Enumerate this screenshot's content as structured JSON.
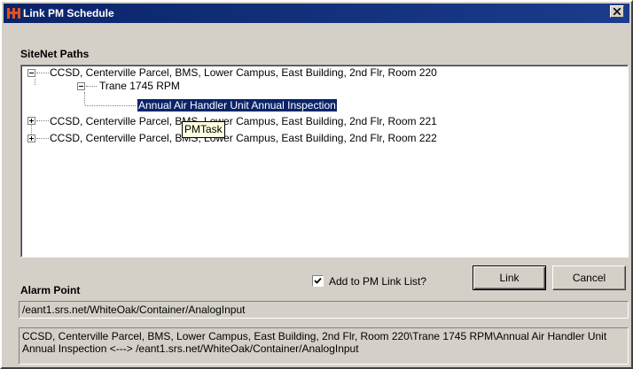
{
  "window": {
    "title": "Link PM Schedule",
    "colors": {
      "titlebar": "#0a246a",
      "face": "#d4d0c8",
      "selection": "#0a246a",
      "tooltip": "#ffffe1"
    }
  },
  "sitenet": {
    "label": "SiteNet Paths",
    "nodes": [
      {
        "text": "CCSD, Centerville Parcel, BMS, Lower Campus, East  Building, 2nd Flr, Room 220",
        "expander": "minus"
      },
      {
        "text": "Trane 1745 RPM",
        "expander": "minus"
      },
      {
        "text": "Annual Air Handler Unit Annual Inspection",
        "selected": true
      },
      {
        "text": "CCSD, Centerville Parcel, BMS, Lower Campus, East  Building, 2nd Flr, Room 221",
        "expander": "plus"
      },
      {
        "text": "CCSD, Centerville Parcel, BMS, Lower Campus, East  Building, 2nd Flr, Room 222",
        "expander": "plus"
      }
    ],
    "tooltip": "PMTask"
  },
  "options": {
    "add_to_list_label": "Add to PM Link List?",
    "add_to_list_checked": true
  },
  "buttons": {
    "link": "Link",
    "cancel": "Cancel"
  },
  "alarm": {
    "label": "Alarm Point",
    "value": "/eant1.srs.net/WhiteOak/Container/AnalogInput",
    "summary_line1": "CCSD, Centerville Parcel, BMS, Lower Campus, East  Building, 2nd Flr, Room 220\\Trane 1745 RPM\\Annual Air Handler Unit",
    "summary_line2": "Annual Inspection <---> /eant1.srs.net/WhiteOak/Container/AnalogInput"
  }
}
